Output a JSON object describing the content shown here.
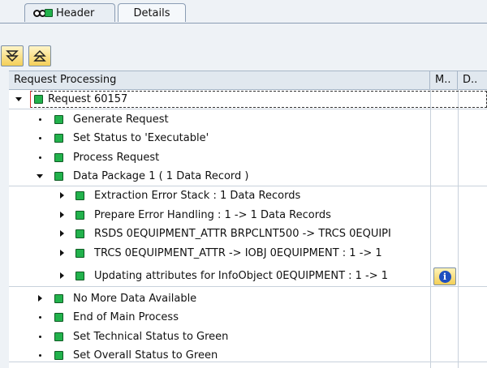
{
  "tabs": [
    {
      "label": "Header",
      "icon": "header-status-icon"
    },
    {
      "label": "Details",
      "active": true
    }
  ],
  "toolbar": {
    "expand_icon": "expand-all-icon",
    "collapse_icon": "collapse-all-icon"
  },
  "table": {
    "columns": [
      "Request Processing",
      "M..",
      "D.."
    ]
  },
  "tree": {
    "root": "Request 60157",
    "steps": [
      "Generate Request",
      "Set Status to 'Executable'",
      "Process Request",
      "Data Package 1 ( 1 Data Record )"
    ],
    "package_children": [
      "Extraction Error Stack : 1 Data Records",
      "Prepare Error Handling : 1 -> 1 Data Records",
      "RSDS 0EQUIPMENT_ATTR BRPCLNT500 -> TRCS 0EQUIPI",
      "TRCS 0EQUIPMENT_ATTR -> IOBJ 0EQUIPMENT : 1 -> 1",
      "Updating attributes for InfoObject 0EQUIPMENT : 1 -> 1"
    ],
    "tail_steps": [
      "No More Data Available",
      "End of Main Process",
      "Set Technical Status to Green",
      "Set Overall Status to Green"
    ]
  },
  "colors": {
    "status_green": "#22b24c",
    "button_yellow": "#f4cf58",
    "info_blue": "#1f4fbf"
  }
}
